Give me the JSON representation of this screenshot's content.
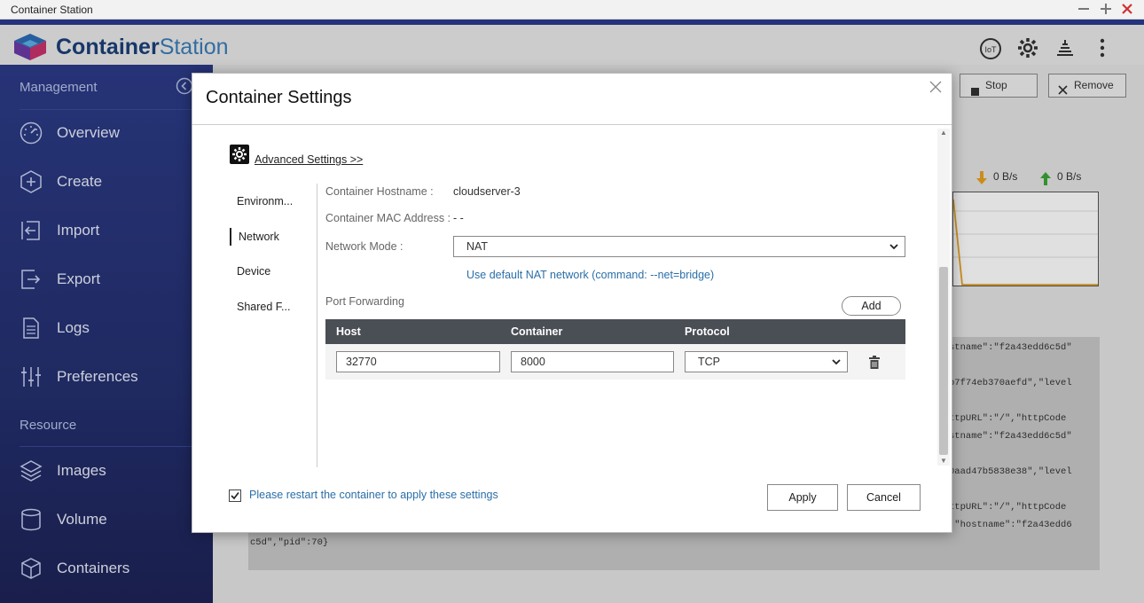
{
  "window": {
    "title": "Container Station",
    "minimize": "—",
    "maximize": "+",
    "close": "✕"
  },
  "header": {
    "logo_part1": "Container",
    "logo_part2": "Station",
    "icons": [
      "iot-icon",
      "gear-icon",
      "stack-icon",
      "more-icon"
    ],
    "iot_label": "IoT"
  },
  "sidebar": {
    "section_management": "Management",
    "section_resource": "Resource",
    "collapse_icon": "‹",
    "management_items": [
      {
        "label": "Overview"
      },
      {
        "label": "Create"
      },
      {
        "label": "Import"
      },
      {
        "label": "Export"
      },
      {
        "label": "Logs"
      },
      {
        "label": "Preferences"
      }
    ],
    "resource_items": [
      {
        "label": "Images"
      },
      {
        "label": "Volume"
      },
      {
        "label": "Containers"
      }
    ]
  },
  "main": {
    "stop_label": "Stop",
    "remove_label": "Remove",
    "download_rate": "0 B/s",
    "upload_rate": "0 B/s",
    "log_lines": [
      "stname\":\"f2a43edd6c5d\"",
      "b7f74eb370aefd\",\"level",
      "ttpURL\":\"/\",\"httpCode",
      "stname\":\"f2a43edd6c5d\"",
      "0aad47b5838e38\",\"level",
      "ttpURL\":\"/\",\"httpCode",
      ",\"hostname\":\"f2a43edd6",
      "c5d\",\"pid\":70}"
    ]
  },
  "modal": {
    "title": "Container Settings",
    "close": "✕",
    "advanced_settings": "Advanced Settings >>",
    "tabs": [
      {
        "label": "Environm..."
      },
      {
        "label": "Network"
      },
      {
        "label": "Device"
      },
      {
        "label": "Shared F..."
      }
    ],
    "hostname_label": "Container Hostname :",
    "hostname_value": "cloudserver-3",
    "mac_label": "Container MAC Address :",
    "mac_value": "- -",
    "network_mode_label": "Network Mode :",
    "network_mode_value": "NAT",
    "network_hint": "Use default NAT network (command: --net=bridge)",
    "port_forwarding_label": "Port Forwarding",
    "add_label": "Add",
    "table_headers": {
      "host": "Host",
      "container": "Container",
      "protocol": "Protocol"
    },
    "port_rows": [
      {
        "host": "32770",
        "container": "8000",
        "protocol": "TCP"
      }
    ],
    "restart_notice": "Please restart the container to apply these settings",
    "restart_checked": true,
    "apply_label": "Apply",
    "cancel_label": "Cancel"
  }
}
